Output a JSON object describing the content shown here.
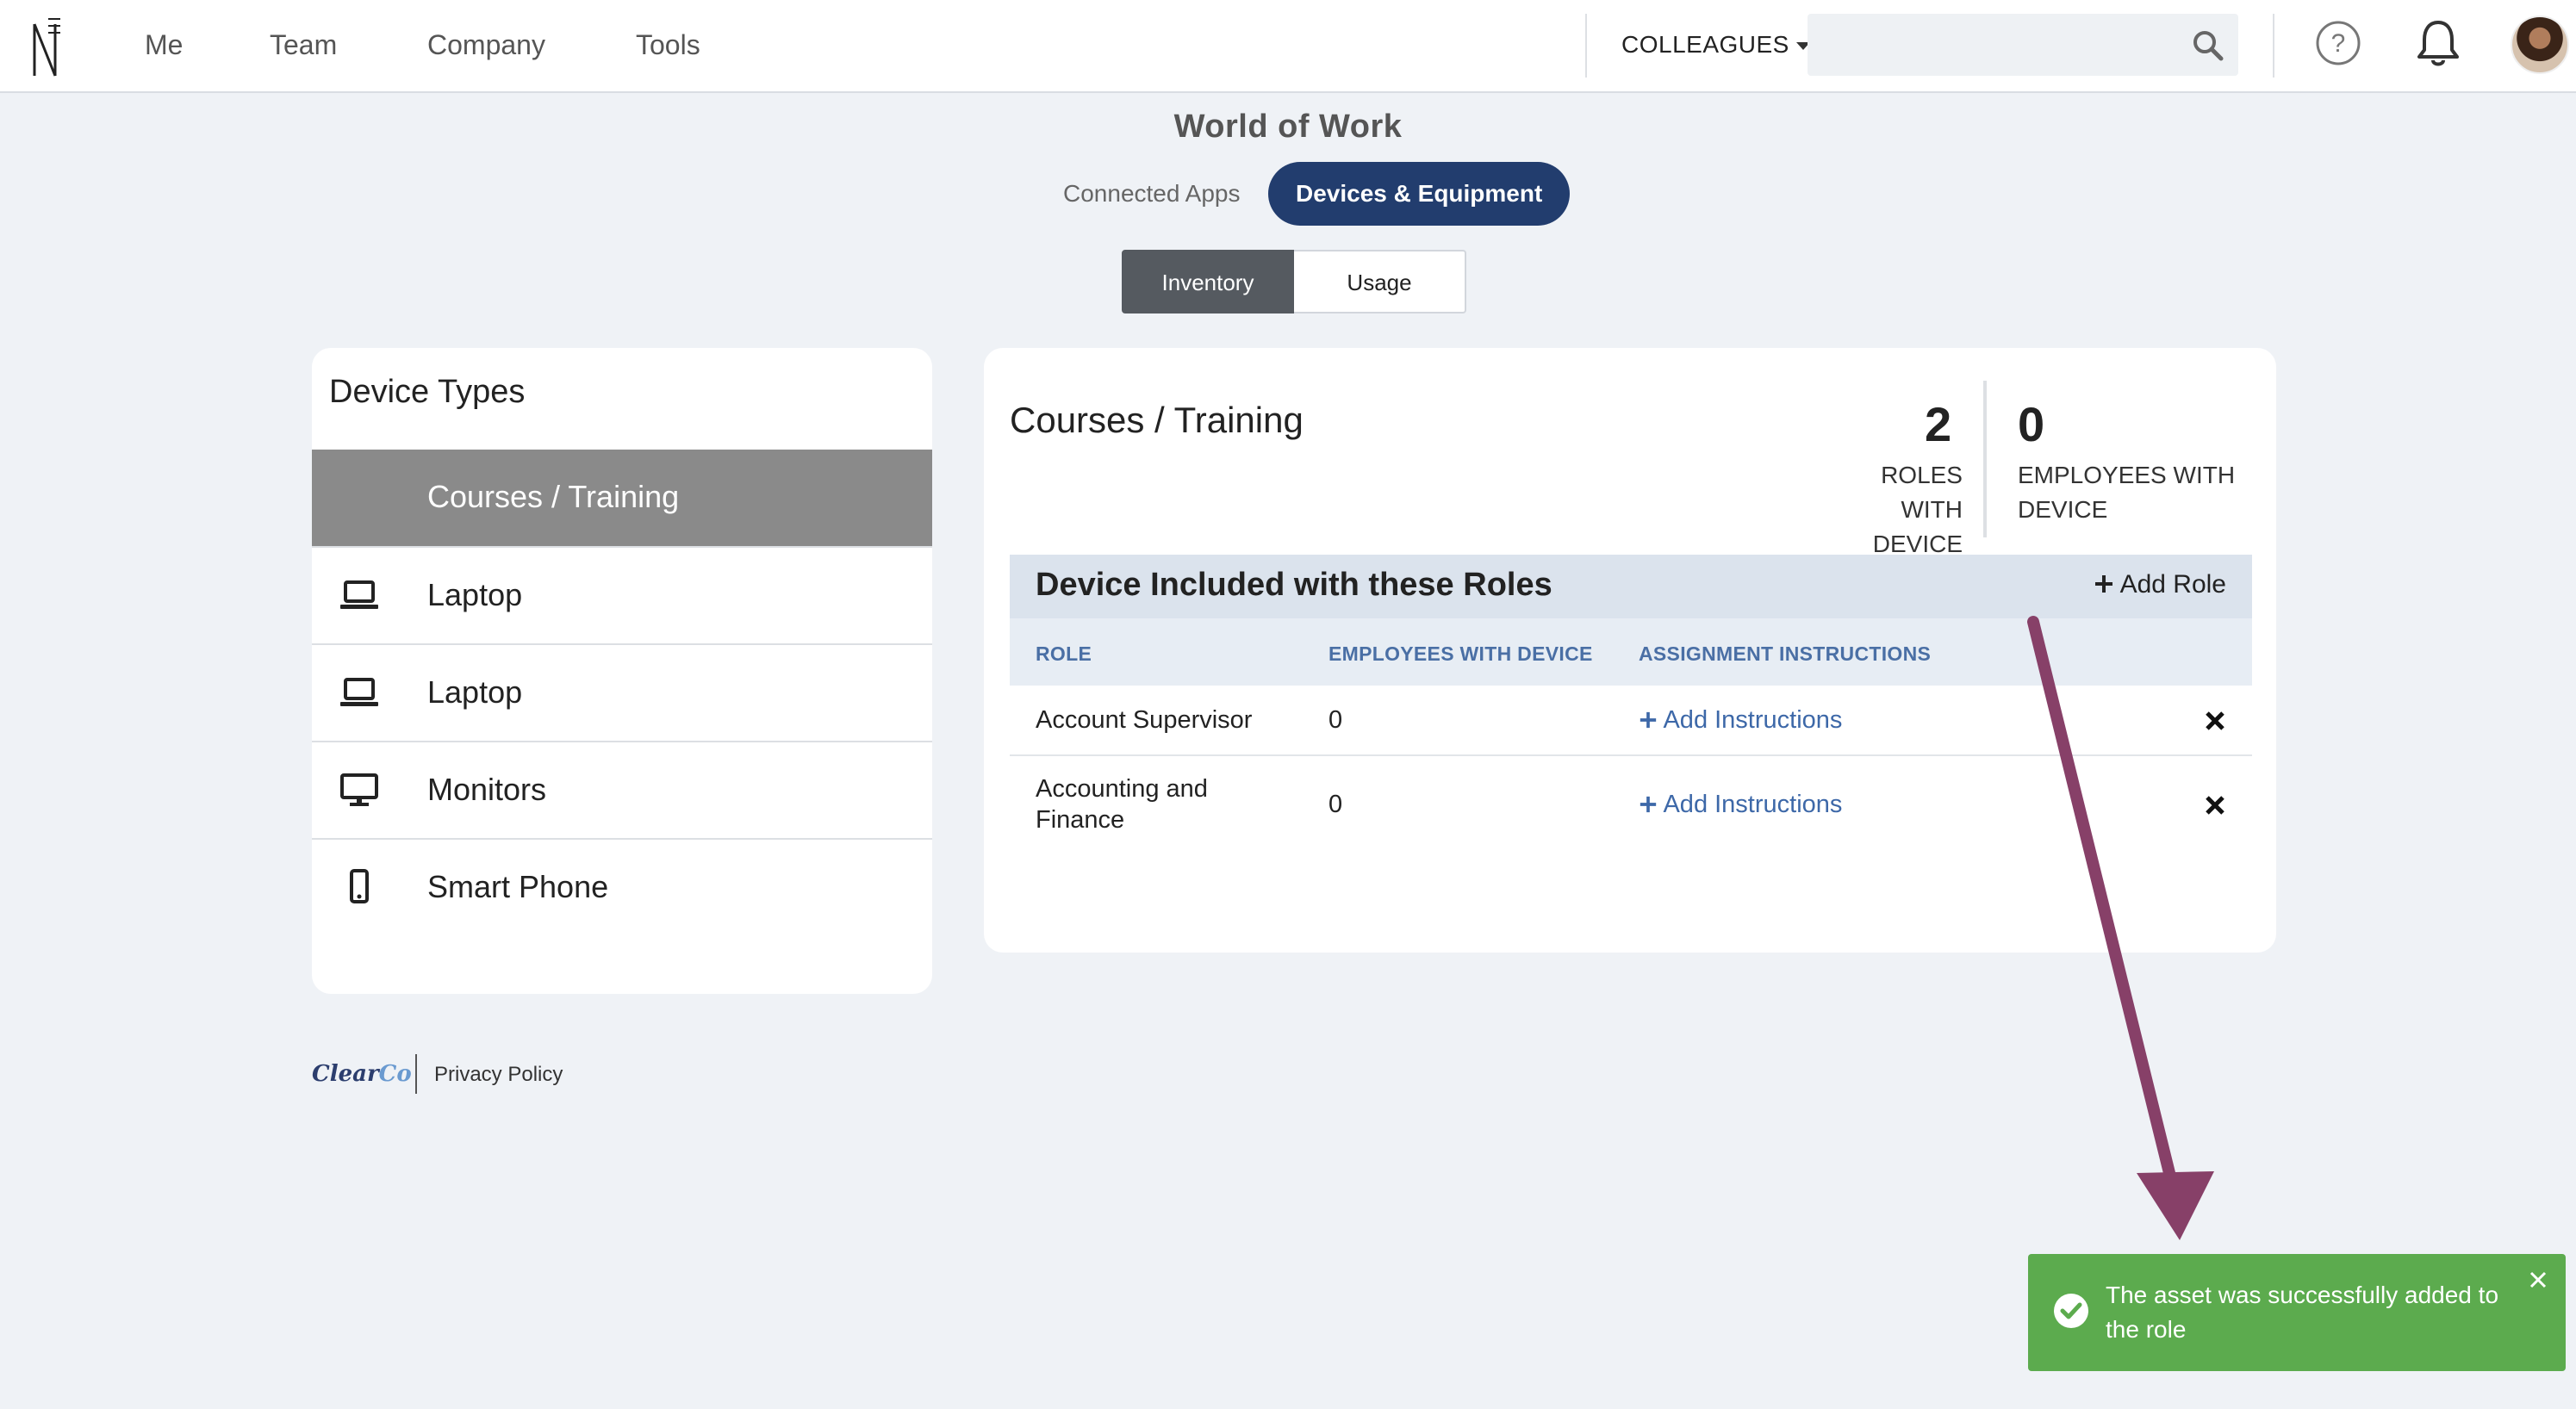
{
  "nav": {
    "items": [
      "Me",
      "Team",
      "Company",
      "Tools"
    ],
    "colleagues": "COLLEAGUES",
    "search_placeholder": "",
    "logo_icon": "n-logo-icon",
    "icons": [
      "search-icon",
      "help-icon",
      "bell-icon",
      "avatar"
    ]
  },
  "page": {
    "title": "World of Work",
    "tabs": [
      {
        "label": "Connected Apps",
        "active": false
      },
      {
        "label": "Devices & Equipment",
        "active": true
      }
    ],
    "segment": [
      {
        "label": "Inventory",
        "active": true
      },
      {
        "label": "Usage",
        "active": false
      }
    ]
  },
  "device_types": {
    "heading": "Device Types",
    "items": [
      {
        "label": "Courses / Training",
        "icon": "none",
        "active": true
      },
      {
        "label": "Laptop",
        "icon": "laptop-icon",
        "active": false
      },
      {
        "label": "Laptop",
        "icon": "laptop-icon",
        "active": false
      },
      {
        "label": "Monitors",
        "icon": "monitor-icon",
        "active": false
      },
      {
        "label": "Smart Phone",
        "icon": "phone-icon",
        "active": false
      }
    ]
  },
  "detail": {
    "title": "Courses / Training",
    "stats": {
      "roles_value": "2",
      "roles_label_1": "ROLES WITH",
      "roles_label_2": "DEVICE",
      "employees_value": "0",
      "employees_label_1": "EMPLOYEES WITH",
      "employees_label_2": "DEVICE"
    },
    "roles_heading": "Device Included with these Roles",
    "add_role": "Add Role",
    "columns": [
      "ROLE",
      "EMPLOYEES WITH DEVICE",
      "ASSIGNMENT INSTRUCTIONS"
    ],
    "rows": [
      {
        "role_1": "Account Supervisor",
        "role_2": "",
        "employees": "0",
        "instructions": "Add Instructions"
      },
      {
        "role_1": "Accounting and",
        "role_2": "Finance",
        "employees": "0",
        "instructions": "Add Instructions"
      }
    ]
  },
  "footer": {
    "brand_a": "Clear",
    "brand_b": "Co",
    "privacy": "Privacy Policy"
  },
  "toast": {
    "message": "The asset was successfully added to the role",
    "color": "#5cab4e"
  },
  "colors": {
    "accent": "#223d6e",
    "link": "#3d68a8",
    "annotation_arrow": "#874068"
  }
}
